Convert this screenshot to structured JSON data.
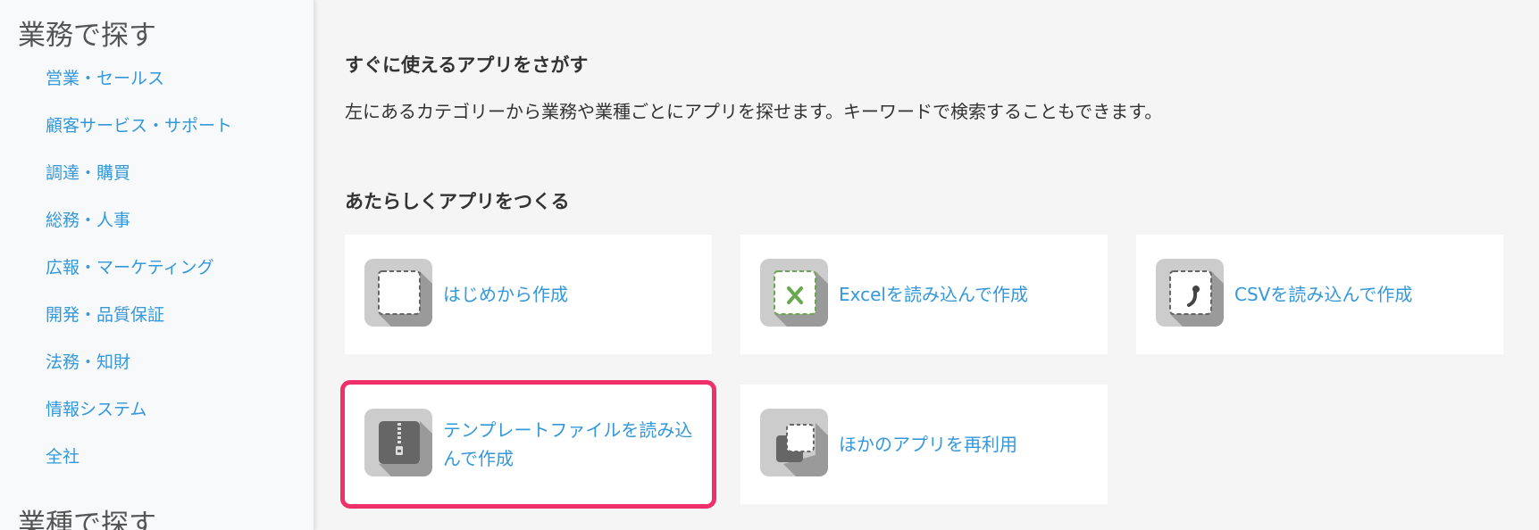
{
  "sidebar": {
    "section1_title": "業務で探す",
    "items": [
      {
        "label": "営業・セールス"
      },
      {
        "label": "顧客サービス・サポート"
      },
      {
        "label": "調達・購買"
      },
      {
        "label": "総務・人事"
      },
      {
        "label": "広報・マーケティング"
      },
      {
        "label": "開発・品質保証"
      },
      {
        "label": "法務・知財"
      },
      {
        "label": "情報システム"
      },
      {
        "label": "全社"
      }
    ],
    "section2_title": "業種で探す"
  },
  "main": {
    "heading_ready": "すぐに使えるアプリをさがす",
    "description": "左にあるカテゴリーから業務や業種ごとにアプリを探せます。キーワードで検索することもできます。",
    "heading_new": "あたらしくアプリをつくる",
    "cards": [
      {
        "label": "はじめから作成",
        "icon": "blank-app-icon"
      },
      {
        "label": "Excelを読み込んで作成",
        "icon": "excel-import-icon"
      },
      {
        "label": "CSVを読み込んで作成",
        "icon": "csv-import-icon"
      },
      {
        "label": "テンプレートファイルを読み込んで作成",
        "icon": "zip-template-icon"
      },
      {
        "label": "ほかのアプリを再利用",
        "icon": "copy-app-icon"
      }
    ]
  },
  "colors": {
    "link": "#3498db",
    "highlight": "#f0306a",
    "excel_green": "#6aa84f"
  }
}
